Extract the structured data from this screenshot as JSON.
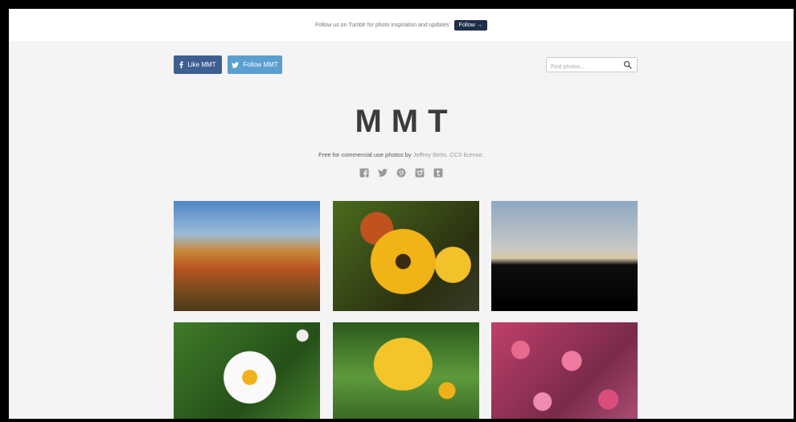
{
  "topbar": {
    "text": "Follow us on Tumblr for photo inspiration and updates",
    "follow_label": "Follow →"
  },
  "header": {
    "like_label": "Like MMT",
    "follow_label": "Follow MMT"
  },
  "search": {
    "placeholder": "Find photos..."
  },
  "site": {
    "title": "MMT",
    "tagline_prefix": "Free for commercial use photos by ",
    "tagline_link": "Jeffrey Betts. CC0 license."
  },
  "social_icons": [
    "facebook-icon",
    "twitter-icon",
    "pinterest-icon",
    "instagram-icon",
    "tumblr-icon"
  ],
  "colors": {
    "follow_button": "#1d2f49",
    "like_button": "#3e5f92",
    "twitter_button": "#5a9fd0"
  }
}
